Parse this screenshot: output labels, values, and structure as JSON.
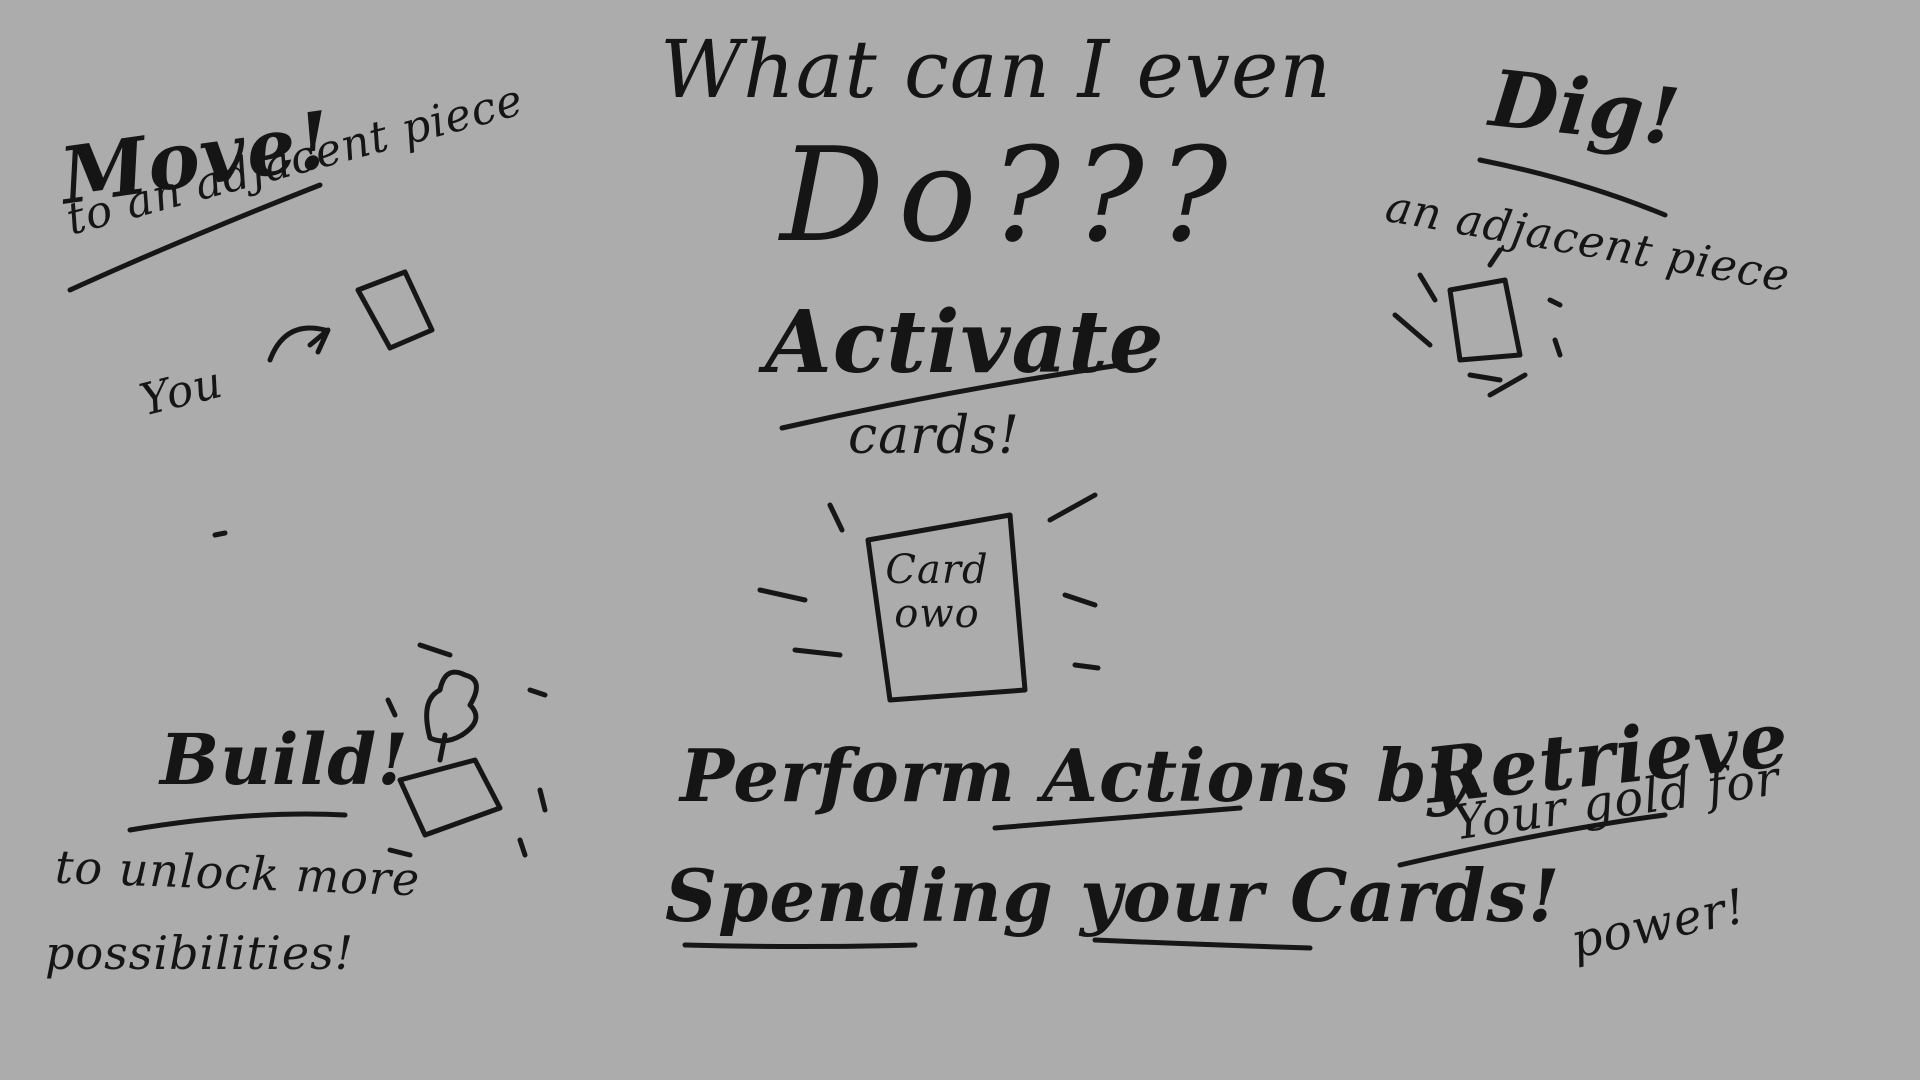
{
  "title": {
    "line1": "What can I even",
    "line2": "Do???"
  },
  "move": {
    "heading": "Move!",
    "sub": "to an adjacent piece",
    "you_label": "You"
  },
  "dig": {
    "heading": "Dig!",
    "sub": "an adjacent piece"
  },
  "activate": {
    "heading": "Activate",
    "sub": "cards!",
    "card_label": "Card owo"
  },
  "build": {
    "heading": "Build!",
    "sub_line1": "to unlock more",
    "sub_line2": "possibilities!"
  },
  "perform": {
    "line1": "Perform Actions by",
    "line2": "Spending your Cards!"
  },
  "retrieve": {
    "heading": "Retrieve",
    "sub_line1": "Your gold for",
    "sub_line2": "power!"
  },
  "colors": {
    "background": "#acacac",
    "ink": "#151515"
  }
}
